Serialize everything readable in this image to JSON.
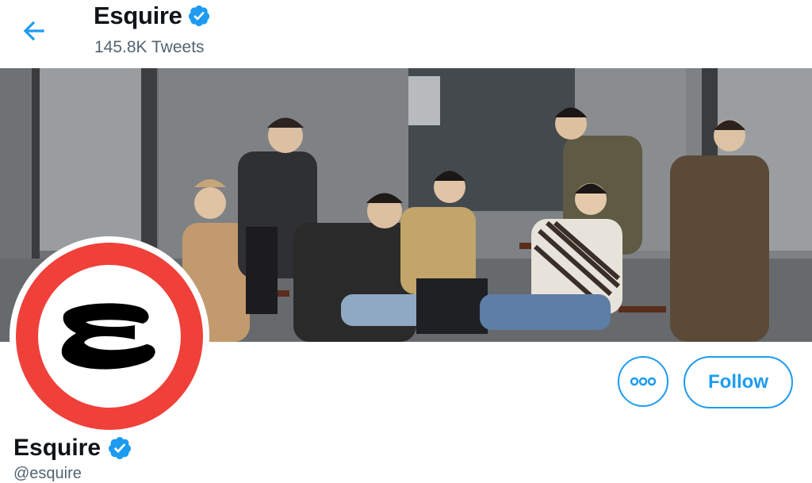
{
  "header": {
    "title": "Esquire",
    "tweet_count": "145.8K Tweets"
  },
  "profile": {
    "name": "Esquire",
    "handle": "@esquire",
    "avatar_letter": "E",
    "avatar_ring_color": "#f0403a",
    "verified": true
  },
  "actions": {
    "more_icon": "more-horizontal-icon",
    "follow_label": "Follow"
  },
  "colors": {
    "accent": "#1d9bf0",
    "badge": "#1d9bf0"
  },
  "banner": {
    "description_icon": "banner-photo"
  }
}
